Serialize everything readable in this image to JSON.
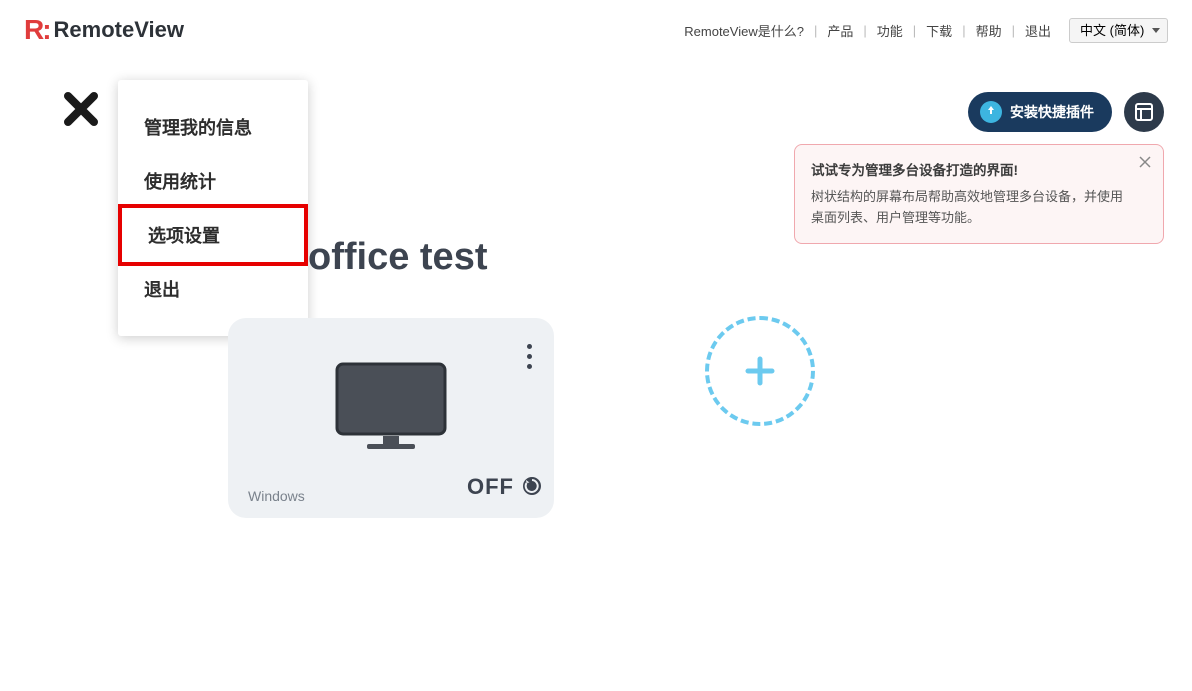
{
  "header": {
    "logo_text": "RemoteView",
    "nav": {
      "what": "RemoteView是什么?",
      "product": "产品",
      "features": "功能",
      "download": "下载",
      "help": "帮助",
      "logout": "退出"
    },
    "language": "中文 (简体)"
  },
  "toolbar": {
    "install_plugin": "安装快捷插件"
  },
  "tip": {
    "title": "试试专为管理多台设备打造的界面!",
    "body": "树状结构的屏幕布局帮助高效地管理多台设备，并使用桌面列表、用户管理等功能。"
  },
  "dropdown": {
    "manage_info": "管理我的信息",
    "usage_stats": "使用统计",
    "option_settings": "选项设置",
    "logout": "退出"
  },
  "page": {
    "title": "office test"
  },
  "device": {
    "os": "Windows",
    "state": "OFF"
  }
}
